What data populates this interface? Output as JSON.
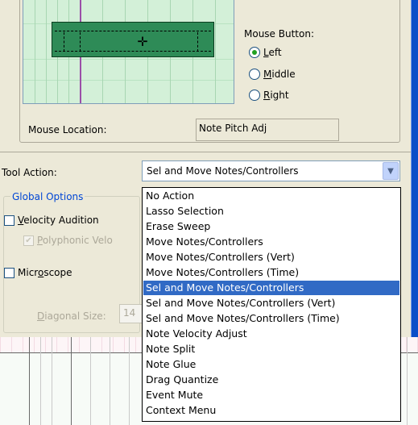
{
  "mouse_button": {
    "title": "Mouse Button:",
    "options": [
      {
        "label": "Left",
        "accel": "L",
        "rest": "eft",
        "selected": true
      },
      {
        "label": "Middle",
        "accel": "M",
        "rest": "iddle",
        "selected": false
      },
      {
        "label": "Right",
        "accel": "R",
        "rest": "ight",
        "selected": false
      }
    ]
  },
  "mouse_location": {
    "label": "Mouse Location:",
    "value": "Note Pitch Adj"
  },
  "tool_action": {
    "label": "Tool Action:",
    "selected": "Sel and Move Notes/Controllers",
    "dropdown_arrow_icon": "chevron-down-icon"
  },
  "global_options": {
    "legend": "Global Options",
    "velocity_audition": {
      "accel": "V",
      "rest": "elocity Audition",
      "checked": false
    },
    "polyphonic_velocity": {
      "accel": "P",
      "rest": "olyphonic Velo",
      "checked": true,
      "disabled": true
    },
    "microscope": {
      "pre": "Micr",
      "accel": "o",
      "rest": "scope",
      "checked": false
    },
    "diagonal_size": {
      "accel": "D",
      "rest": "iagonal Size:",
      "value": "14",
      "disabled": true
    }
  },
  "dropdown_items": [
    "No Action",
    "Lasso Selection",
    "Erase Sweep",
    "Move Notes/Controllers",
    "Move Notes/Controllers (Vert)",
    "Move Notes/Controllers (Time)",
    "Sel and Move Notes/Controllers",
    "Sel and Move Notes/Controllers (Vert)",
    "Sel and Move Notes/Controllers (Time)",
    "Note Velocity Adjust",
    "Note Split",
    "Note Glue",
    "Drag Quantize",
    "Event Mute",
    "Context Menu"
  ],
  "dropdown_selected_index": 6,
  "colors": {
    "selection": "#316ac5",
    "note": "#2e8b57",
    "dialog_bg": "#ece9d8",
    "group_legend": "#0046d5"
  }
}
